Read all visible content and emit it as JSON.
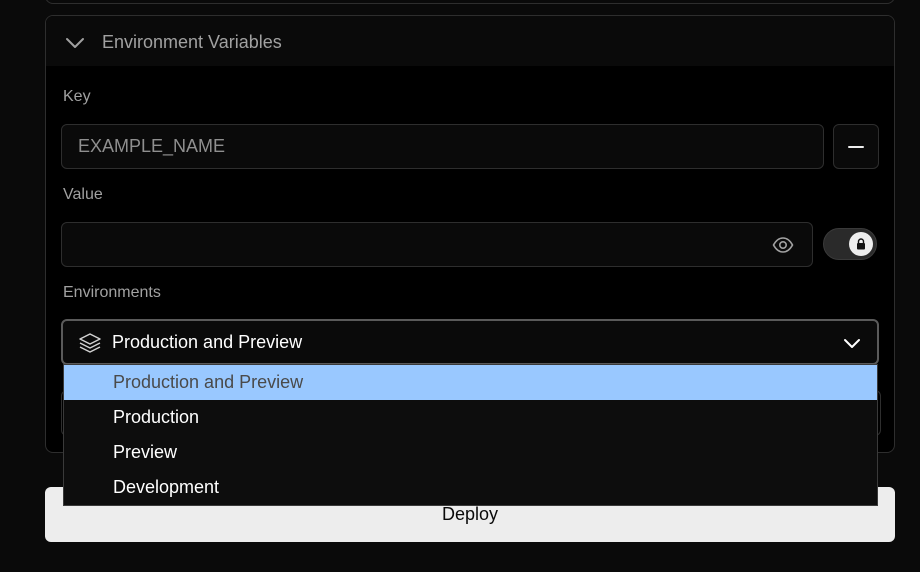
{
  "section": {
    "title": "Environment Variables"
  },
  "key": {
    "label": "Key",
    "placeholder": "EXAMPLE_NAME"
  },
  "value": {
    "label": "Value",
    "placeholder": ""
  },
  "environments": {
    "label": "Environments",
    "selected": "Production and Preview",
    "options": [
      {
        "label": "Production and Preview",
        "highlighted": true
      },
      {
        "label": "Production",
        "highlighted": false
      },
      {
        "label": "Preview",
        "highlighted": false
      },
      {
        "label": "Development",
        "highlighted": false
      }
    ]
  },
  "deploy": {
    "label": "Deploy"
  },
  "icons": {
    "collapse": "chevron-down-icon",
    "remove": "minus-icon",
    "reveal": "eye-icon",
    "sensitive": "lock-icon",
    "environments": "layers-icon",
    "dropdown": "chevron-down-icon"
  },
  "colors": {
    "background": "#0a0a0a",
    "panel": "#000000",
    "border": "#2e2e2e",
    "highlight": "#99c8ff",
    "button": "#ededed"
  }
}
